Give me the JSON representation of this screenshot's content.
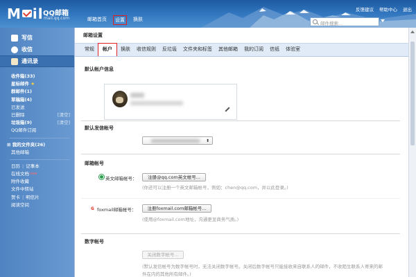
{
  "header": {
    "logo_text": "QQ邮箱",
    "logo_sub": "mail.qq.com",
    "nav": [
      "邮箱首页",
      "设置",
      "换肤"
    ],
    "active_nav": "设置",
    "top_links": [
      "反馈建议",
      "帮助中心",
      "退出"
    ],
    "search_placeholder": "邮件搜索..."
  },
  "sidebar": {
    "buttons": [
      {
        "label": "写信",
        "icon": "compose-icon"
      },
      {
        "label": "收信",
        "icon": "inbox-icon"
      },
      {
        "label": "通讯录",
        "icon": "contacts-icon"
      }
    ],
    "folders": [
      {
        "label": "收件箱(33)",
        "bold": true,
        "extra": ""
      },
      {
        "label": "星标邮件",
        "bold": true,
        "extra": "",
        "star": true
      },
      {
        "label": "群邮件(1)",
        "bold": true,
        "extra": ""
      },
      {
        "label": "草稿箱(4)",
        "bold": true,
        "extra": ""
      },
      {
        "label": "已发送",
        "bold": false,
        "extra": ""
      },
      {
        "label": "已删除",
        "bold": false,
        "extra": "[清空]"
      },
      {
        "label": "垃圾箱(9)",
        "bold": true,
        "extra": "[清空]"
      },
      {
        "label": "QQ邮件订阅",
        "bold": false,
        "extra": ""
      }
    ],
    "my_folders": "我的文件夹(26)",
    "other_mailbox": "其他邮箱",
    "apps_row1": [
      "日历",
      "记事本"
    ],
    "apps": [
      "在线文档",
      "附件收藏",
      "文件中转站"
    ],
    "apps_row2": [
      "贺卡",
      "明信片"
    ],
    "reading": "阅读空间"
  },
  "main": {
    "title": "邮箱设置",
    "tabs": [
      "常规",
      "帐户",
      "换肤",
      "收信规则",
      "反垃圾",
      "文件夹和标签",
      "其他邮箱",
      "我的订阅",
      "信纸",
      "体验室"
    ],
    "active_tab": "帐户",
    "sections": {
      "default_account": "默认帐户信息",
      "default_sender": "默认发信帐号",
      "mail_account": "邮箱帐号",
      "digital_account": "数字帐号"
    },
    "english_label": "英文邮箱帐号：",
    "english_button": "注册@qq.com英文帐号...",
    "english_hint": "(你还可以注册一个英文邮箱帐号，例如：chen@qq.com，并以此登录。)",
    "foxmail_label": "foxmail邮箱帐号：",
    "foxmail_button": "注册foxmail.com邮箱帐号...",
    "foxmail_hint": "(使用@foxmail.com地址，沟通更显商务气质。)",
    "digital_button": "关闭数字帐号...",
    "digital_hint1": "(默认发信帐号为数字帐号时，无法关闭数字帐号。关闭后数字帐号只能接收来自联系人的邮件，不收陌生联系人寄来的邮",
    "digital_hint2": "件在内的其他所有邮件。)"
  }
}
